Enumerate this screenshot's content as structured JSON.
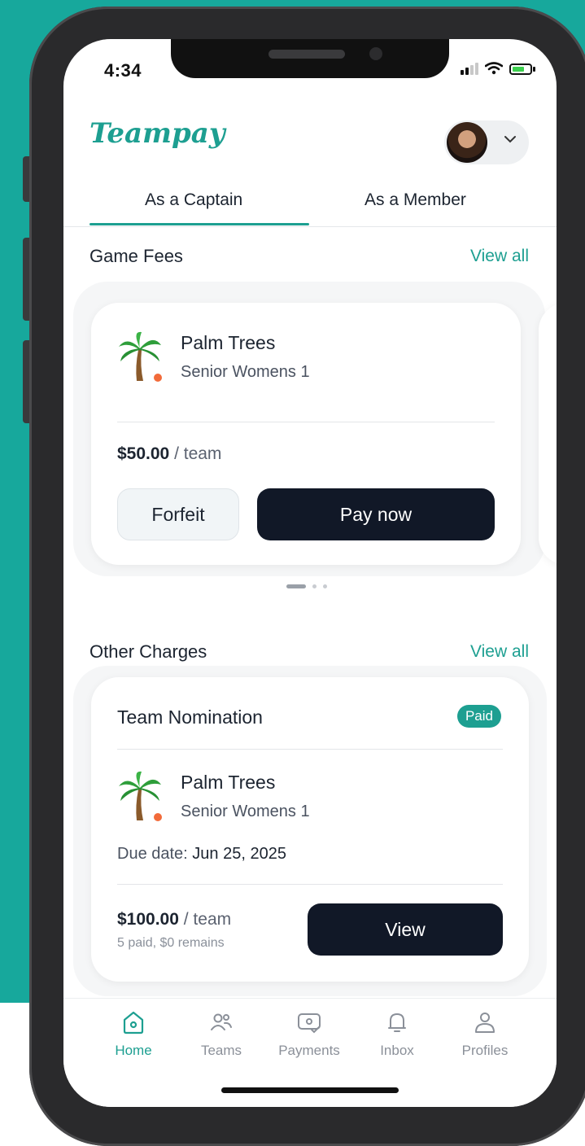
{
  "status_bar": {
    "time": "4:34"
  },
  "header": {
    "logo_text": "Teampay",
    "avatar_alt": "user avatar"
  },
  "tabs": [
    {
      "label": "As a Captain",
      "active": true
    },
    {
      "label": "As a Member",
      "active": false
    }
  ],
  "game_fees": {
    "title": "Game Fees",
    "view_all": "View all",
    "card": {
      "team_name": "Palm Trees",
      "division": "Senior Womens 1",
      "amount": "$50.00",
      "unit": " / team",
      "forfeit_label": "Forfeit",
      "pay_label": "Pay now"
    },
    "carousel_pages": 3,
    "carousel_active": 1
  },
  "other_charges": {
    "title": "Other Charges",
    "view_all": "View all",
    "card": {
      "charge_title": "Team Nomination",
      "status": "Paid",
      "team_name": "Palm Trees",
      "division": "Senior Womens 1",
      "due_prefix": "Due date: ",
      "due_date": "Jun 25, 2025",
      "amount": "$100.00",
      "unit": " / team",
      "summary": "5 paid, $0 remains",
      "view_label": "View"
    }
  },
  "bottom_nav": [
    {
      "label": "Home",
      "icon": "home-icon",
      "active": true
    },
    {
      "label": "Teams",
      "icon": "teams-icon",
      "active": false
    },
    {
      "label": "Payments",
      "icon": "payments-icon",
      "active": false
    },
    {
      "label": "Inbox",
      "icon": "bell-icon",
      "active": false
    },
    {
      "label": "Profiles",
      "icon": "profile-icon",
      "active": false
    }
  ],
  "colors": {
    "accent": "#1d9f91",
    "background_teal": "#17a89c",
    "dark_button": "#111827"
  }
}
